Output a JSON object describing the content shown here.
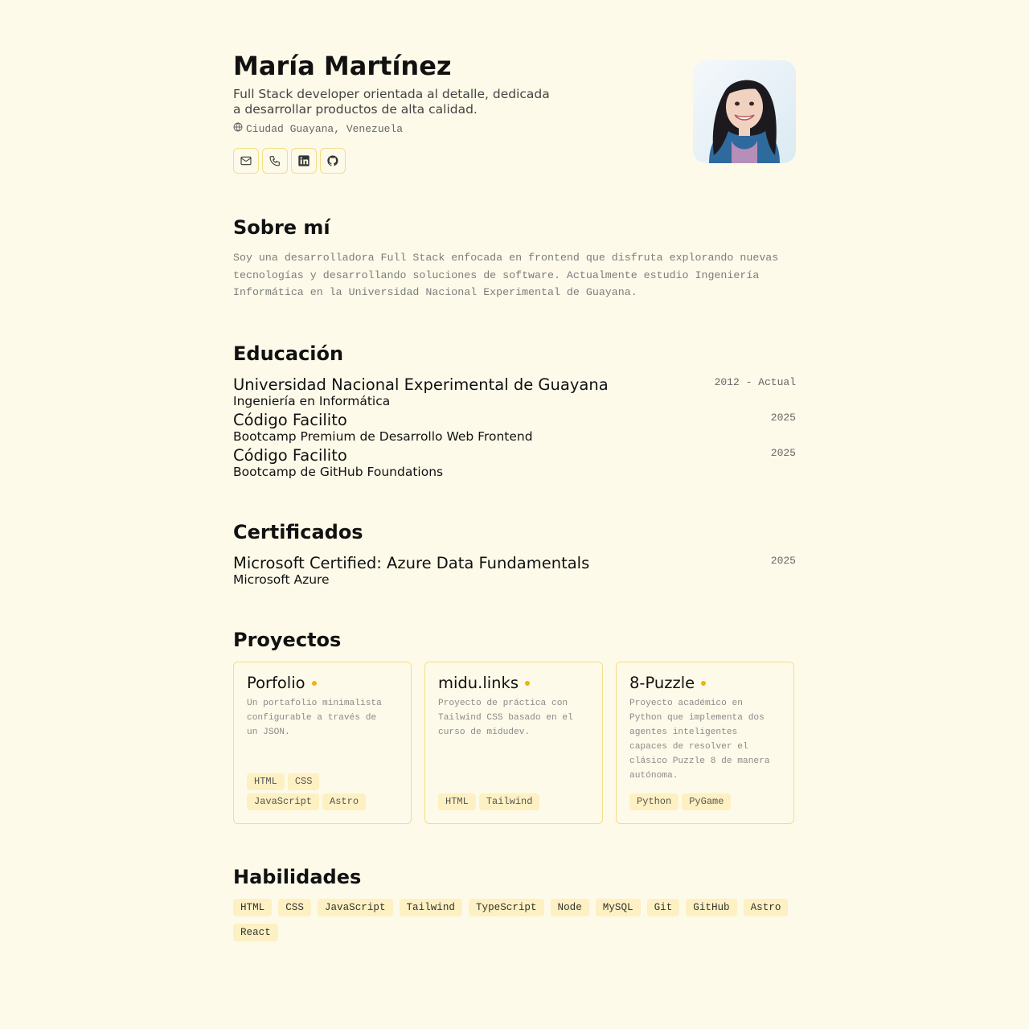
{
  "header": {
    "name": "María Martínez",
    "subtitle": "Full Stack developer orientada al detalle, dedicada a desarrollar productos de alta calidad.",
    "location": "Ciudad Guayana, Venezuela",
    "location_icon": "globe-icon",
    "contacts": [
      {
        "icon": "mail-icon"
      },
      {
        "icon": "phone-icon"
      },
      {
        "icon": "linkedin-icon"
      },
      {
        "icon": "github-icon"
      }
    ]
  },
  "about": {
    "title": "Sobre mí",
    "text": "Soy una desarrolladora Full Stack enfocada en frontend que disfruta explorando nuevas tecnologías y desarrollando soluciones de software. Actualmente estudio Ingeniería Informática en la Universidad Nacional Experimental de Guayana."
  },
  "education": {
    "title": "Educación",
    "items": [
      {
        "institution": "Universidad Nacional Experimental de Guayana",
        "degree": "Ingeniería en Informática",
        "date": "2012 - Actual"
      },
      {
        "institution": "Código Facilito",
        "degree": "Bootcamp Premium de Desarrollo Web Frontend",
        "date": "2025"
      },
      {
        "institution": "Código Facilito",
        "degree": "Bootcamp de GitHub Foundations",
        "date": "2025"
      }
    ]
  },
  "certificates": {
    "title": "Certificados",
    "items": [
      {
        "name": "Microsoft Certified: Azure Data Fundamentals",
        "issuer": "Microsoft Azure",
        "date": "2025"
      }
    ]
  },
  "projects": {
    "title": "Proyectos",
    "items": [
      {
        "name": "Porfolio",
        "description": "Un portafolio minimalista configurable a través de un JSON.",
        "tags": [
          "HTML",
          "CSS",
          "JavaScript",
          "Astro"
        ]
      },
      {
        "name": "midu.links",
        "description": "Proyecto de práctica con Tailwind CSS basado en el curso de midudev.",
        "tags": [
          "HTML",
          "Tailwind"
        ]
      },
      {
        "name": "8-Puzzle",
        "description": "Proyecto académico en Python que implementa dos agentes inteligentes capaces de resolver el clásico Puzzle 8 de manera autónoma.",
        "tags": [
          "Python",
          "PyGame"
        ]
      }
    ]
  },
  "skills": {
    "title": "Habilidades",
    "items": [
      "HTML",
      "CSS",
      "JavaScript",
      "Tailwind",
      "TypeScript",
      "Node",
      "MySQL",
      "Git",
      "GitHub",
      "Astro",
      "React"
    ]
  },
  "colors": {
    "background": "#fefae9",
    "accent_border": "#f3dd86",
    "tag_background": "#fdf0c2",
    "status_dot": "#f3b10c"
  }
}
